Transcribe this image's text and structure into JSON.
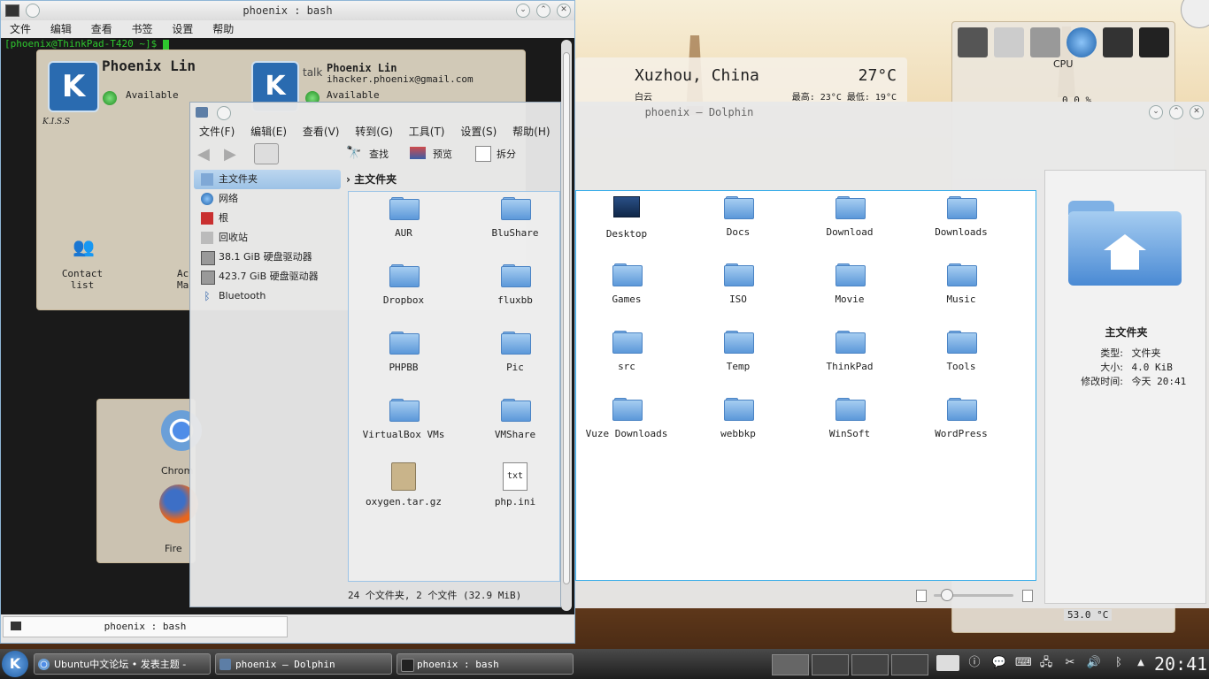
{
  "terminal": {
    "title": "phoenix : bash",
    "menu": [
      "文件",
      "编辑",
      "查看",
      "书签",
      "设置",
      "帮助"
    ],
    "prompt": "[phoenix@ThinkPad-T420 ~]$ ",
    "tab_label": "phoenix : bash"
  },
  "kopete": {
    "name": "Phoenix Lin",
    "status": "Available",
    "motto": "K.I.S.S",
    "contact_name": "Phoenix Lin",
    "contact_email": "ihacker.phoenix@gmail.com",
    "contact_status": "Available",
    "talk_label": "talk",
    "contact_list_label": "Contact list",
    "partial_label": "Ac Ma"
  },
  "weather": {
    "city": "Xuzhou, China",
    "temp": "27°C",
    "condition": "白云",
    "high_low": "最高: 23°C  最低: 19°C"
  },
  "sysmon": {
    "cpu_label": "CPU",
    "cpu_value": "0.0 %",
    "temp_value": "53.0 °C"
  },
  "launcher": {
    "chrome_label": "Chrom",
    "firefox_label": "Fire"
  },
  "dolphin_small": {
    "menu": [
      "文件(F)",
      "编辑(E)",
      "查看(V)",
      "转到(G)",
      "工具(T)",
      "设置(S)",
      "帮助(H)"
    ],
    "toolbar": {
      "find": "查找",
      "preview": "预览",
      "split": "拆分"
    },
    "places": [
      "主文件夹",
      "网络",
      "根",
      "回收站",
      "38.1 GiB 硬盘驱动器",
      "423.7 GiB 硬盘驱动器",
      "Bluetooth"
    ],
    "breadcrumb": "主文件夹",
    "items": [
      "AUR",
      "BluShare",
      "Dropbox",
      "fluxbb",
      "PHPBB",
      "Pic",
      "VirtualBox VMs",
      "VMShare",
      "oxygen.tar.gz",
      "php.ini"
    ],
    "status": "24 个文件夹, 2 个文件 (32.9 MiB)"
  },
  "dolphin": {
    "title": "phoenix – Dolphin",
    "items": [
      "Desktop",
      "Docs",
      "Download",
      "Downloads",
      "Games",
      "ISO",
      "Movie",
      "Music",
      "src",
      "Temp",
      "ThinkPad",
      "Tools",
      "Vuze Downloads",
      "webbkp",
      "WinSoft",
      "WordPress"
    ],
    "info": {
      "name": "主文件夹",
      "type_label": "类型:",
      "type_value": "文件夹",
      "size_label": "大小:",
      "size_value": "4.0 KiB",
      "mtime_label": "修改时间:",
      "mtime_value": "今天 20:41"
    }
  },
  "taskbar": {
    "tasks": [
      "Ubuntu中文论坛 • 发表主题 -",
      "phoenix – Dolphin",
      "phoenix : bash"
    ],
    "clock": "20:41"
  },
  "colors": {
    "accent": "#3daee9",
    "terminal_bg": "#1a1a1a",
    "prompt": "#2ec72e",
    "panel": "#2a2a2a"
  }
}
